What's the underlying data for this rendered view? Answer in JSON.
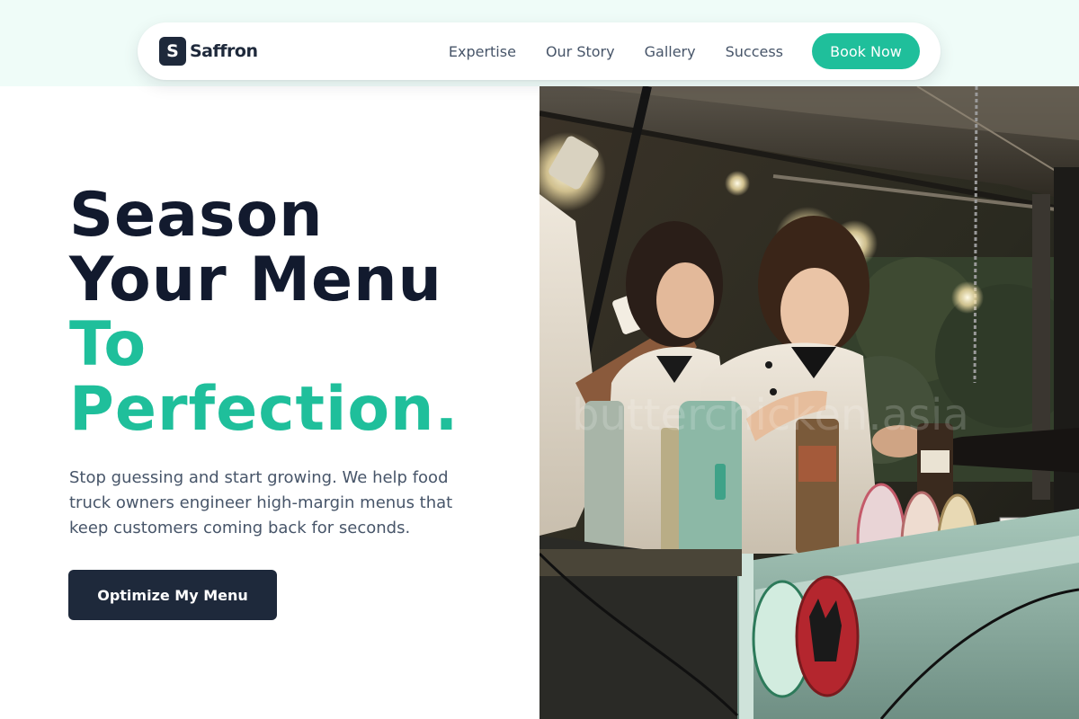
{
  "brand": {
    "logo_letter": "S",
    "name": "Saffron"
  },
  "nav": {
    "links": [
      "Expertise",
      "Our Story",
      "Gallery",
      "Success"
    ],
    "cta_label": "Book Now"
  },
  "hero": {
    "title_line1": "Season",
    "title_line2": "Your Menu",
    "title_line3": "To",
    "title_line4": "Perfection.",
    "subtitle": "Stop guessing and start growing. We help food truck owners engineer high-margin menus that keep customers coming back for seconds.",
    "cta_label": "Optimize My Menu"
  },
  "image": {
    "description_icon": "food-truck-photo",
    "watermark": "butterchicken.asia"
  },
  "colors": {
    "accent": "#1fbf9b",
    "dark": "#121a2e",
    "button_dark": "#1e293b",
    "topbar_bg": "#effcf8"
  }
}
